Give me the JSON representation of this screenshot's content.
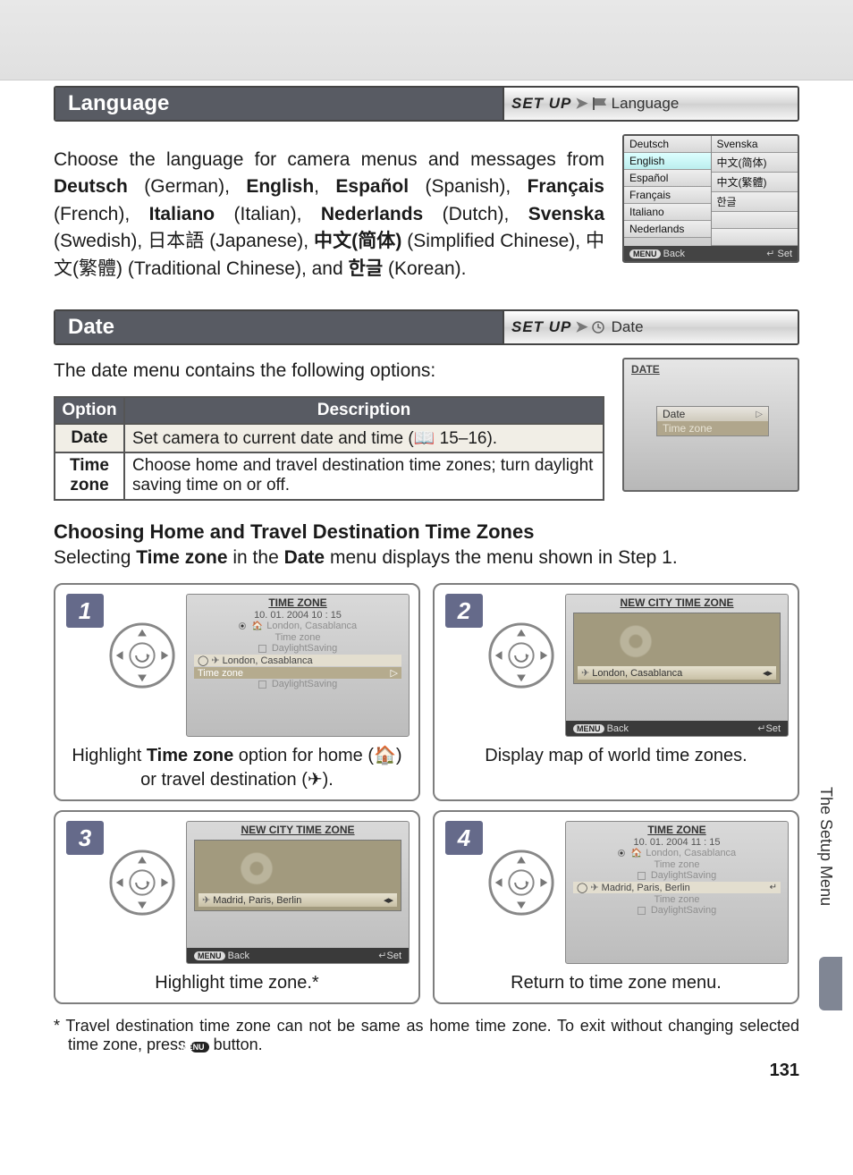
{
  "page_number": "131",
  "side_tab": "The Setup Menu",
  "sections": {
    "language": {
      "title": "Language",
      "crumb_setup": "SET UP",
      "crumb_name": "Language",
      "body_html": "Choose the language for camera menus and messages from <b>Deutsch</b> (German), <b>English</b>, <b>Español</b> (Spanish), <b>Français</b> (French), <b>Italiano</b> (Italian), <b>Nederlands</b> (Dutch), <b>Svenska</b> (Swedish), 日本語 (Japanese), <b>中文(简体)</b> (Simplified Chinese), 中文(繁體) (Traditional Chinese), and <b>한글</b> (Korean).",
      "screen": {
        "col1": [
          "Deutsch",
          "English",
          "Español",
          "Français",
          "Italiano",
          "Nederlands"
        ],
        "col2": [
          "Svenska",
          "中文(简体)",
          "中文(繁體)",
          "한글",
          "",
          ""
        ],
        "selected": "English",
        "footer_back": "Back",
        "footer_set": "Set",
        "menu_label": "MENU"
      }
    },
    "date": {
      "title": "Date",
      "crumb_setup": "SET UP",
      "crumb_name": "Date",
      "intro": "The date menu contains the following options:",
      "screen": {
        "title": "DATE",
        "row1": "Date",
        "row2": "Time zone"
      },
      "table": {
        "head_option": "Option",
        "head_desc": "Description",
        "rows": [
          {
            "option": "Date",
            "desc": "Set camera to current date and time (📖 15–16)."
          },
          {
            "option": "Time zone",
            "desc": "Choose home and travel destination time zones; turn daylight saving time on or off."
          }
        ]
      }
    },
    "timezones": {
      "subhead": "Choosing Home and Travel Destination Time Zones",
      "subdesc_html": "Selecting <b>Time zone</b> in the <b>Date</b> menu displays the menu shown in Step 1.",
      "steps": [
        {
          "num": "1",
          "lcd_title": "TIME ZONE",
          "datetime": "10. 01. 2004  10 : 15",
          "home_city": "London, Casablanca",
          "tz_label": "Time zone",
          "ds_label": "DaylightSaving",
          "travel_city": "London, Casablanca",
          "caption_html": "Highlight <b>Time zone</b> option for home (🏠) or travel destination (✈)."
        },
        {
          "num": "2",
          "lcd_title": "NEW CITY TIME ZONE",
          "city": "London, Casablanca",
          "footer_back": "Back",
          "footer_set": "Set",
          "menu_label": "MENU",
          "caption": "Display map of world time zones."
        },
        {
          "num": "3",
          "lcd_title": "NEW CITY TIME ZONE",
          "city": "Madrid, Paris, Berlin",
          "footer_back": "Back",
          "footer_set": "Set",
          "menu_label": "MENU",
          "caption": "Highlight time zone.*"
        },
        {
          "num": "4",
          "lcd_title": "TIME ZONE",
          "datetime": "10. 01. 2004  11 : 15",
          "home_city": "London, Casablanca",
          "tz_label": "Time zone",
          "ds_label": "DaylightSaving",
          "travel_city": "Madrid, Paris, Berlin",
          "caption": "Return to time zone menu."
        }
      ],
      "footnote_html": "* Travel destination time zone can not be same as home time zone.  To exit without changing selected time zone, press <span class='icon-pill'>MENU</span> button."
    }
  }
}
